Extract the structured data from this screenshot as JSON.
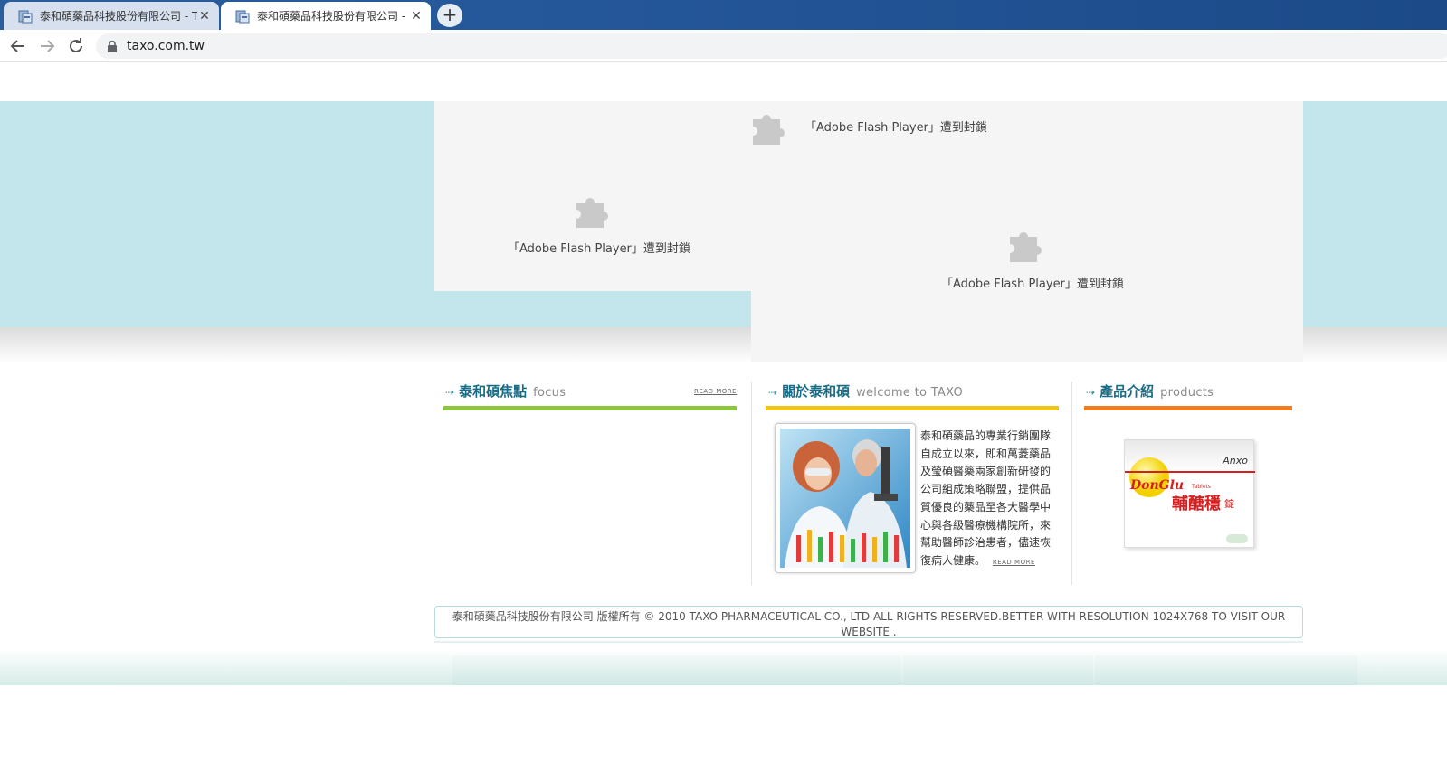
{
  "browser": {
    "tabs": [
      {
        "title": "泰和碩藥品科技股份有限公司 - T",
        "active": false
      },
      {
        "title": "泰和碩藥品科技股份有限公司 - T",
        "active": true
      }
    ],
    "close_glyph": "✕",
    "new_tab_glyph": "+",
    "url": "taxo.com.tw",
    "icons": [
      "back-arrow-icon",
      "forward-arrow-icon",
      "reload-icon",
      "lock-icon"
    ]
  },
  "flash": {
    "blocked_message": "「Adobe Flash Player」遭到封鎖",
    "icon": "puzzle-piece-icon"
  },
  "sections": {
    "focus": {
      "title_zh": "泰和碩焦點",
      "title_en": "focus",
      "read_more": "READ MORE",
      "rule_color": "#8cc63f"
    },
    "about": {
      "title_zh": "關於泰和碩",
      "title_en": "welcome to TAXO",
      "read_more": "READ MORE",
      "rule_color": "#f0c419",
      "body": "泰和碩藥品的專業行銷團隊自成立以來，即和萬菱藥品及瑩碩醫藥兩家創新研發的公司組成策略聯盟，提供品質優良的藥品至各大醫學中心與各級醫療機構院所，來幫助醫師診治患者，儘速恢復病人健康。"
    },
    "products": {
      "title_zh": "產品介紹",
      "title_en": "products",
      "rule_color": "#f07c1f",
      "product_brand": "DonGlu",
      "product_brand_sub": "Tablets",
      "product_name": "輔醣穩",
      "product_suffix": "錠",
      "maker": "Anxo"
    }
  },
  "footer": {
    "copyright": "泰和碩藥品科技股份有限公司 版權所有 © 2010 TAXO PHARMACEUTICAL CO., LTD ALL RIGHTS RESERVED.BETTER WITH RESOLUTION 1024X768 TO VISIT OUR WEBSITE ."
  },
  "colors": {
    "band": "#c3e6ec",
    "title_zh": "#1a6d86",
    "flash_bg": "#f5f5f5"
  }
}
